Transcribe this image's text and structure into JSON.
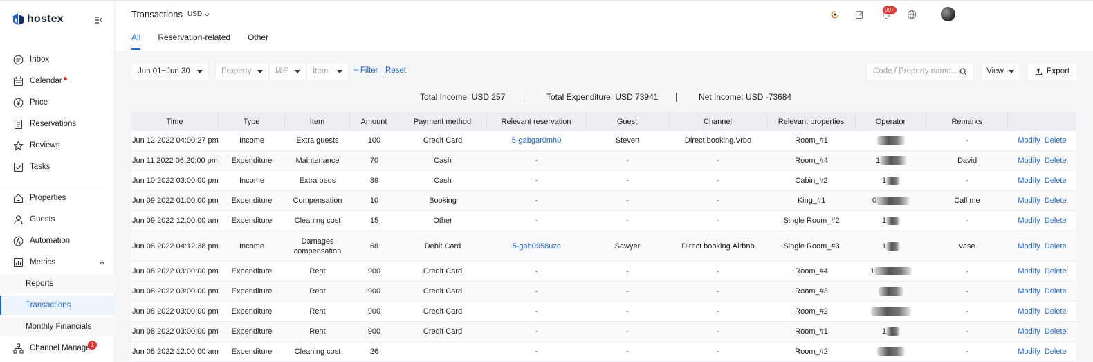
{
  "brand": "hostex",
  "sidebar": {
    "items": [
      {
        "label": "Inbox",
        "icon": "inbox-icon"
      },
      {
        "label": "Calendar",
        "icon": "calendar-icon"
      },
      {
        "label": "Price",
        "icon": "yen-icon"
      },
      {
        "label": "Reservations",
        "icon": "document-icon"
      },
      {
        "label": "Reviews",
        "icon": "star-icon"
      },
      {
        "label": "Tasks",
        "icon": "checkbox-icon"
      },
      {
        "label": "Properties",
        "icon": "house-icon"
      },
      {
        "label": "Guests",
        "icon": "user-icon"
      },
      {
        "label": "Automation",
        "icon": "automation-icon"
      },
      {
        "label": "Metrics",
        "icon": "chart-icon"
      }
    ],
    "sub_items": [
      {
        "label": "Reports"
      },
      {
        "label": "Transactions"
      },
      {
        "label": "Monthly Financials"
      }
    ],
    "channel_manager": {
      "label": "Channel Manager",
      "badge": "1"
    }
  },
  "header": {
    "title": "Transactions",
    "currency": "USD",
    "notification_badge": "99+",
    "tabs": [
      {
        "label": "All"
      },
      {
        "label": "Reservation-related"
      },
      {
        "label": "Other"
      }
    ]
  },
  "filters": {
    "date_range": "Jun 01~Jun 30",
    "property": "Property",
    "ie": "I&E",
    "item": "Item",
    "add_filter": "+ Filter",
    "reset": "Reset",
    "search_placeholder": "Code / Property name...",
    "view": "View",
    "export": "Export"
  },
  "summary": {
    "income": "Total Income: USD 257",
    "expenditure": "Total Expenditure: USD 73941",
    "net": "Net Income: USD -73684"
  },
  "table": {
    "columns": [
      "Time",
      "Type",
      "Item",
      "Amount",
      "Payment method",
      "Relevant reservation",
      "Guest",
      "Channel",
      "Relevant properties",
      "Operator",
      "Remarks",
      ""
    ],
    "modify_label": "Modify",
    "delete_label": "Delete",
    "rows": [
      {
        "time": "Jun 12 2022 04:00:27 pm",
        "type": "Income",
        "item": "Extra guests",
        "amount": "100",
        "payment": "Credit Card",
        "reservation": "5-gabgar0mh0",
        "guest": "Steven",
        "channel": "Direct booking.Vrbo",
        "property": "Room_#1",
        "operator": "",
        "remarks": "-"
      },
      {
        "time": "Jun 11 2022 06:20:00 pm",
        "type": "Expenditure",
        "item": "Maintenance",
        "amount": "70",
        "payment": "Cash",
        "reservation": "-",
        "guest": "-",
        "channel": "-",
        "property": "Room_#4",
        "operator": "1",
        "remarks": "David"
      },
      {
        "time": "Jun 10 2022 03:00:00 pm",
        "type": "Income",
        "item": "Extra beds",
        "amount": "89",
        "payment": "Cash",
        "reservation": "-",
        "guest": "-",
        "channel": "-",
        "property": "Cabin_#2",
        "operator": "1",
        "remarks": "-"
      },
      {
        "time": "Jun 09 2022 01:00:00 pm",
        "type": "Expenditure",
        "item": "Compensation",
        "amount": "10",
        "payment": "Booking",
        "reservation": "-",
        "guest": "-",
        "channel": "-",
        "property": "King_#1",
        "operator": "0",
        "remarks": "Call me"
      },
      {
        "time": "Jun 09 2022 12:00:00 am",
        "type": "Expenditure",
        "item": "Cleaning cost",
        "amount": "15",
        "payment": "Other",
        "reservation": "-",
        "guest": "-",
        "channel": "-",
        "property": "Single Room_#2",
        "operator": "1",
        "remarks": "-"
      },
      {
        "time": "Jun 08 2022 04:12:38 pm",
        "type": "Income",
        "item": "Damages compensation",
        "amount": "68",
        "payment": "Debit Card",
        "reservation": "5-gah0958uzc",
        "guest": "Sawyer",
        "channel": "Direct booking.Airbnb",
        "property": "Single Room_#3",
        "operator": "1",
        "remarks": "vase"
      },
      {
        "time": "Jun 08 2022 03:00:00 pm",
        "type": "Expenditure",
        "item": "Rent",
        "amount": "900",
        "payment": "Credit Card",
        "reservation": "-",
        "guest": "-",
        "channel": "-",
        "property": "Room_#4",
        "operator": "1",
        "remarks": "-"
      },
      {
        "time": "Jun 08 2022 03:00:00 pm",
        "type": "Expenditure",
        "item": "Rent",
        "amount": "900",
        "payment": "Credit Card",
        "reservation": "-",
        "guest": "-",
        "channel": "-",
        "property": "Room_#3",
        "operator": "",
        "remarks": "-"
      },
      {
        "time": "Jun 08 2022 03:00:00 pm",
        "type": "Expenditure",
        "item": "Rent",
        "amount": "900",
        "payment": "Credit Card",
        "reservation": "-",
        "guest": "-",
        "channel": "-",
        "property": "Room_#2",
        "operator": "",
        "remarks": "-"
      },
      {
        "time": "Jun 08 2022 03:00:00 pm",
        "type": "Expenditure",
        "item": "Rent",
        "amount": "900",
        "payment": "Credit Card",
        "reservation": "-",
        "guest": "-",
        "channel": "-",
        "property": "Room_#1",
        "operator": "1",
        "remarks": "-"
      },
      {
        "time": "Jun 08 2022 12:00:00 am",
        "type": "Expenditure",
        "item": "Cleaning cost",
        "amount": "26",
        "payment": "",
        "reservation": "-",
        "guest": "-",
        "channel": "-",
        "property": "Room_#2",
        "operator": "",
        "remarks": "-"
      }
    ]
  },
  "colors": {
    "accent": "#1b66d9",
    "badge": "#e5322d"
  }
}
